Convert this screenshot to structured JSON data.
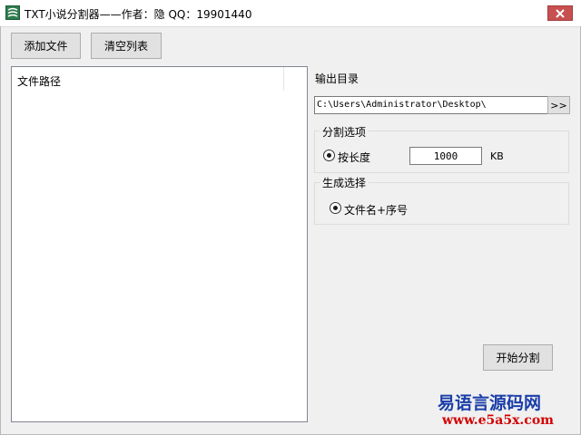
{
  "window": {
    "title": "TXT小说分割器——作者：隐 QQ：19901440",
    "close_label": "×"
  },
  "toolbar": {
    "add_file": "添加文件",
    "clear_list": "清空列表"
  },
  "file_list": {
    "column_header": "文件路径",
    "rows": []
  },
  "output": {
    "label": "输出目录",
    "path": "C:\\Users\\Administrator\\Desktop\\",
    "browse_label": ">>"
  },
  "split_options": {
    "group_title": "分割选项",
    "by_length_label": "按长度",
    "by_length_selected": true,
    "length_value": "1000",
    "unit": "KB"
  },
  "generate": {
    "group_title": "生成选择",
    "filename_seq_label": "文件名+序号",
    "filename_seq_selected": true
  },
  "start_button": "开始分割",
  "watermark": {
    "line1": "易语言源码网",
    "line2": "www.e5a5x.com"
  },
  "colors": {
    "window_bg": "#f0f0f0",
    "close_button": "#c75050",
    "watermark_blue": "#1a3ea8",
    "watermark_red": "#d40000"
  },
  "icons": {
    "app": "txt-splitter-app-icon",
    "close": "close-icon"
  }
}
